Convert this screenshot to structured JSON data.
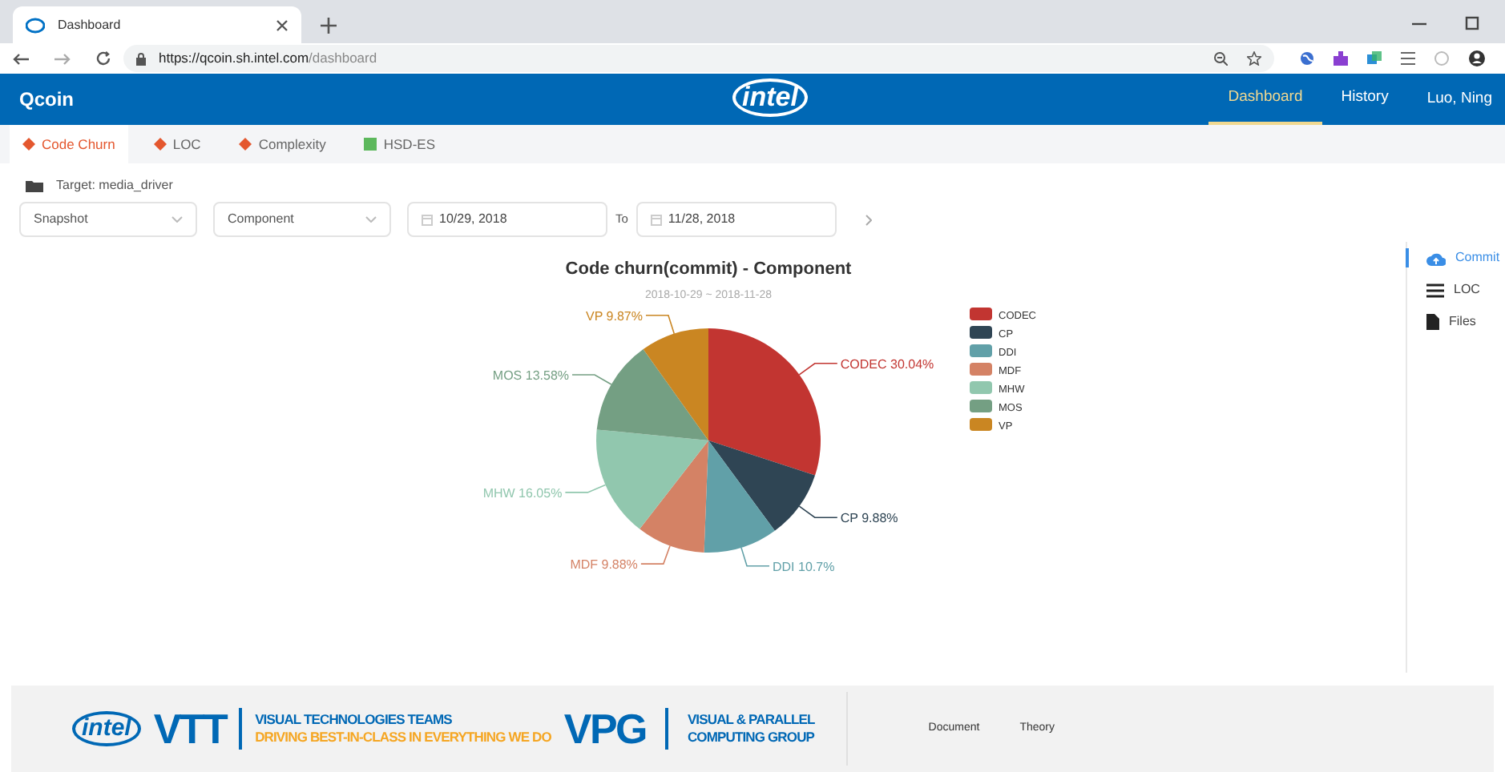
{
  "browser": {
    "tab_title": "Dashboard",
    "url_host": "https://qcoin.sh.intel.com",
    "url_path": "/dashboard"
  },
  "header": {
    "app_name": "Qcoin",
    "logo_text": "intel",
    "nav": [
      {
        "label": "Dashboard",
        "selected": true
      },
      {
        "label": "History",
        "selected": false
      }
    ],
    "user": "Luo, Ning"
  },
  "tabs": [
    {
      "label": "Code Churn",
      "kind": "git",
      "selected": true
    },
    {
      "label": "LOC",
      "kind": "git",
      "selected": false
    },
    {
      "label": "Complexity",
      "kind": "git",
      "selected": false
    },
    {
      "label": "HSD-ES",
      "kind": "hsd",
      "selected": false
    }
  ],
  "target": "Target: media_driver",
  "filters": {
    "view": "Snapshot",
    "group_by": "Component",
    "date_from": "10/29, 2018",
    "to_label": "To",
    "date_to": "11/28, 2018"
  },
  "chart": {
    "chart_data": {
      "type": "pie",
      "title": "Code churn(commit) - Component",
      "subtitle": "2018-10-29 ~ 2018-11-28",
      "categories": [
        "CODEC",
        "CP",
        "DDI",
        "MDF",
        "MHW",
        "MOS",
        "VP"
      ],
      "series": [
        {
          "colors": [
            "#c23531",
            "#2f4554",
            "#61a0a8",
            "#d48265",
            "#91c7ae",
            "#749f83",
            "#ca8622"
          ],
          "values": [
            30.04,
            9.88,
            10.7,
            9.88,
            16.05,
            13.58,
            9.87
          ]
        }
      ],
      "value_labels": [
        "CODEC 30.04%",
        "CP 9.88%",
        "DDI 10.7%",
        "MDF 9.88%",
        "MHW 16.05%",
        "MOS 13.58%",
        "VP 9.87%"
      ],
      "legend": true
    }
  },
  "side_nav": [
    {
      "label": "Commit",
      "kind": "cloud",
      "selected": true
    },
    {
      "label": "LOC",
      "kind": "list",
      "selected": false
    },
    {
      "label": "Files",
      "kind": "file",
      "selected": false
    }
  ],
  "footer": {
    "logo_text": "intel",
    "team_abbr": "VTT",
    "team_name": "VISUAL TECHNOLOGIES TEAMS",
    "team_motto": "DRIVING BEST-IN-CLASS IN EVERYTHING WE DO",
    "group_abbr": "VPG",
    "group_name_1": "VISUAL & PARALLEL",
    "group_name_2": "COMPUTING GROUP",
    "links": [
      "Document",
      "Theory"
    ]
  }
}
